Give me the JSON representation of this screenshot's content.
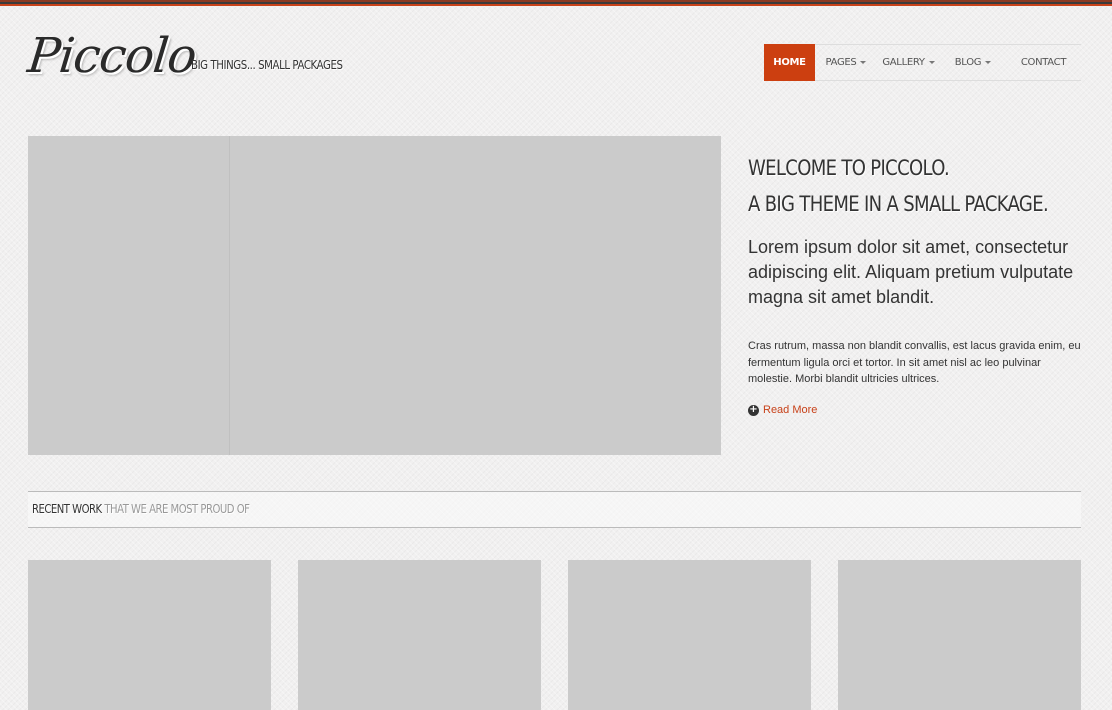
{
  "brand": {
    "logo_text": "Piccolo",
    "tagline": "BIG THINGS... SMALL PACKAGES"
  },
  "nav": {
    "items": [
      {
        "label": "HOME",
        "active": true,
        "dropdown": false
      },
      {
        "label": "PAGES",
        "active": false,
        "dropdown": true
      },
      {
        "label": "GALLERY",
        "active": false,
        "dropdown": true
      },
      {
        "label": "BLOG",
        "active": false,
        "dropdown": true
      },
      {
        "label": "CONTACT",
        "active": false,
        "dropdown": false
      }
    ]
  },
  "hero": {
    "title_line1": "WELCOME TO PICCOLO.",
    "title_line2": "A BIG THEME IN A SMALL PACKAGE.",
    "lead": "Lorem ipsum dolor sit amet, consectetur adipiscing elit. Aliquam pretium vulputate magna sit amet blandit.",
    "body": "Cras rutrum, massa non blandit convallis, est lacus gravida enim, eu fermentum ligula orci et tortor. In sit amet nisl ac leo pulvinar molestie. Morbi blandit ultricies ultrices.",
    "read_more": "Read More",
    "read_more_icon": "plus-circle-icon"
  },
  "recent_work": {
    "title_strong": "RECENT WORK",
    "title_muted": "THAT WE ARE MOST PROUD OF"
  },
  "colors": {
    "accent": "#cc3f10",
    "link": "#c8421a",
    "placeholder": "#cbcbcb"
  }
}
